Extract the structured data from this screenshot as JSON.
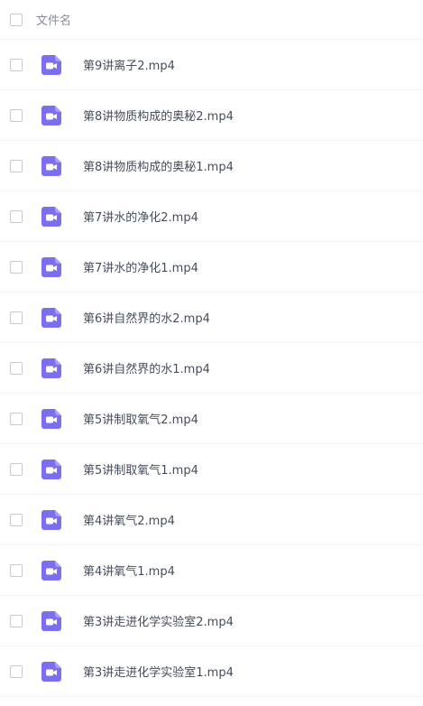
{
  "header": {
    "column_label": "文件名"
  },
  "files": [
    {
      "name": "第9讲离子2.mp4",
      "icon": "video-file-icon"
    },
    {
      "name": "第8讲物质构成的奥秘2.mp4",
      "icon": "video-file-icon"
    },
    {
      "name": "第8讲物质构成的奥秘1.mp4",
      "icon": "video-file-icon"
    },
    {
      "name": "第7讲水的净化2.mp4",
      "icon": "video-file-icon"
    },
    {
      "name": "第7讲水的净化1.mp4",
      "icon": "video-file-icon"
    },
    {
      "name": "第6讲自然界的水2.mp4",
      "icon": "video-file-icon"
    },
    {
      "name": "第6讲自然界的水1.mp4",
      "icon": "video-file-icon"
    },
    {
      "name": "第5讲制取氧气2.mp4",
      "icon": "video-file-icon"
    },
    {
      "name": "第5讲制取氧气1.mp4",
      "icon": "video-file-icon"
    },
    {
      "name": "第4讲氧气2.mp4",
      "icon": "video-file-icon"
    },
    {
      "name": "第4讲氧气1.mp4",
      "icon": "video-file-icon"
    },
    {
      "name": "第3讲走进化学实验室2.mp4",
      "icon": "video-file-icon"
    },
    {
      "name": "第3讲走进化学实验室1.mp4",
      "icon": "video-file-icon"
    }
  ],
  "colors": {
    "icon_purple": "#7b6ff0",
    "text": "#454d5a",
    "header_text": "#878c9c",
    "divider": "#f1f2f5",
    "checkbox_border": "#c5c9d1"
  }
}
